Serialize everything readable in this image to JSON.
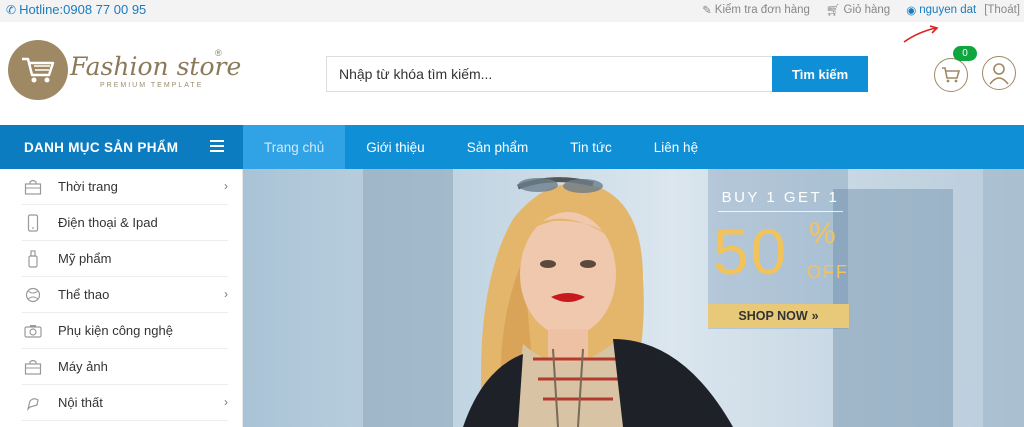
{
  "topbar": {
    "hotline": "Hotline:0908 77 00 95",
    "order_check": "Kiểm tra đơn hàng",
    "cart": "Giỏ hàng",
    "username": "nguyen dat",
    "logout": "[Thoát]"
  },
  "logo": {
    "name": "Fashion store",
    "reg": "®",
    "tagline": "PREMIUM TEMPLATE"
  },
  "search": {
    "placeholder": "Nhập từ khóa tìm kiếm...",
    "button": "Tìm kiếm"
  },
  "cart": {
    "count": "0"
  },
  "nav": {
    "category_header": "DANH MỤC SẢN PHẨM",
    "items": [
      {
        "label": "Trang chủ",
        "active": true
      },
      {
        "label": "Giới thiệu"
      },
      {
        "label": "Sản phẩm"
      },
      {
        "label": "Tin tức"
      },
      {
        "label": "Liên hệ"
      }
    ]
  },
  "sidebar": {
    "items": [
      {
        "label": "Thời trang",
        "icon": "bag-icon",
        "submenu": true
      },
      {
        "label": "Điện thoại & Ipad",
        "icon": "phone-icon",
        "submenu": false
      },
      {
        "label": "Mỹ phẩm",
        "icon": "cosmetic-icon",
        "submenu": false
      },
      {
        "label": "Thể thao",
        "icon": "ball-icon",
        "submenu": true
      },
      {
        "label": "Phụ kiện công nghệ",
        "icon": "camera-accessory-icon",
        "submenu": false
      },
      {
        "label": "Máy ảnh",
        "icon": "camera-bag-icon",
        "submenu": false
      },
      {
        "label": "Nội thất",
        "icon": "furniture-icon",
        "submenu": true
      }
    ]
  },
  "banner": {
    "headline": "BUY 1 GET 1",
    "discount": "50",
    "percent": "%",
    "off": "OFF",
    "cta": "SHOP NOW",
    "cta_arrow": "»"
  },
  "colors": {
    "primary": "#0e8fd6",
    "primary_dark": "#0c7cc0",
    "brand": "#9e8964",
    "badge": "#0fa53f",
    "accent_gold": "#f2c35a"
  }
}
